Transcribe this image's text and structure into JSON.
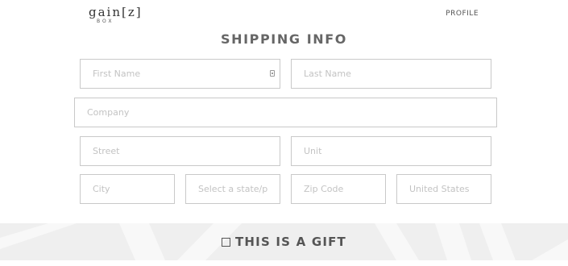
{
  "header": {
    "logo_main": "gain[z]",
    "logo_sub": "BOX",
    "profile_label": "PROFILE"
  },
  "page_title": "SHIPPING INFO",
  "form": {
    "first_name_placeholder": "First Name",
    "last_name_placeholder": "Last Name",
    "company_placeholder": "Company",
    "street_placeholder": "Street",
    "unit_placeholder": "Unit",
    "city_placeholder": "City",
    "state_placeholder": "Select a state/p",
    "zip_placeholder": "Zip Code",
    "country_placeholder": "United States"
  },
  "gift": {
    "label": "THIS IS A GIFT",
    "checked": false
  },
  "colors": {
    "band_background": "#efefef",
    "band_stripes": "#f8f8f8",
    "border": "#c9c9c9",
    "title": "#666666"
  },
  "icons": [
    "autofill-key-icon",
    "checkbox-icon"
  ]
}
